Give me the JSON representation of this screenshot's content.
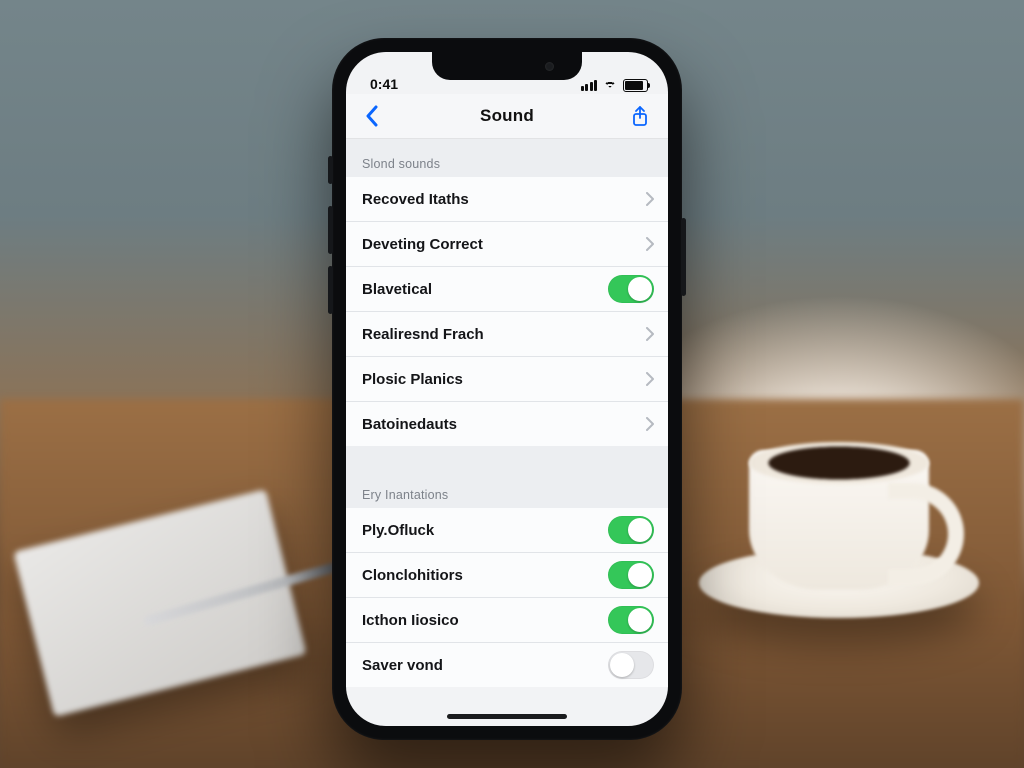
{
  "status": {
    "time": "0:41"
  },
  "nav": {
    "title": "Sound"
  },
  "sections": [
    {
      "header": "Slond sounds",
      "rows": [
        {
          "label": "Recoved Itaths",
          "accessory": "disclosure"
        },
        {
          "label": "Deveting Correct",
          "accessory": "disclosure"
        },
        {
          "label": "Blavetical",
          "accessory": "toggle",
          "on": true
        },
        {
          "label": "Realiresnd Frach",
          "accessory": "disclosure"
        },
        {
          "label": "Plosic Planics",
          "accessory": "disclosure"
        },
        {
          "label": "Batoinedauts",
          "accessory": "disclosure"
        }
      ]
    },
    {
      "header": "Ery Inantations",
      "rows": [
        {
          "label": "Ply.Ofluck",
          "accessory": "toggle",
          "on": true
        },
        {
          "label": "Clonclohitiors",
          "accessory": "toggle",
          "on": true
        },
        {
          "label": "Icthon Iiosico",
          "accessory": "toggle",
          "on": true
        },
        {
          "label": "Saver vond",
          "accessory": "toggle",
          "on": false
        }
      ]
    }
  ],
  "colors": {
    "tint": "#0a66ff",
    "toggle_on": "#34c759"
  }
}
